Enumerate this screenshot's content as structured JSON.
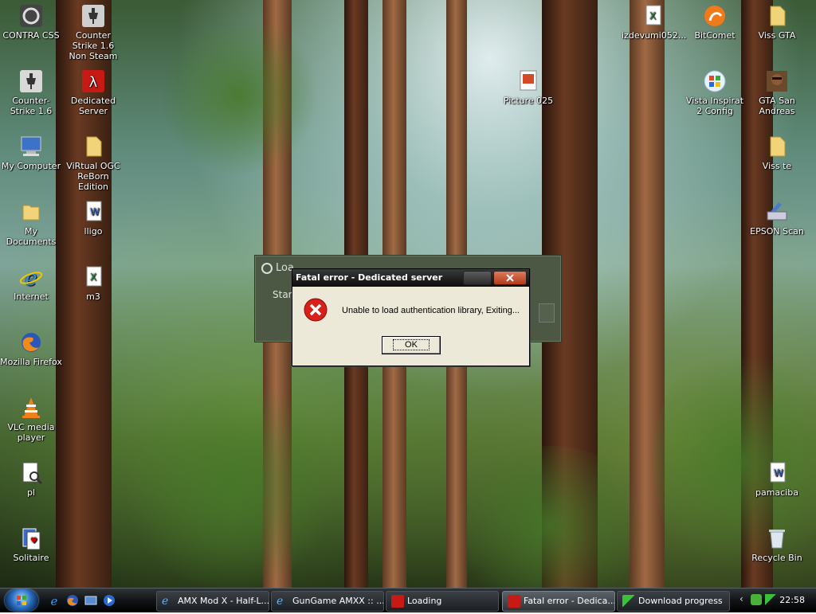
{
  "desktop": {
    "icons": [
      {
        "label": "CONTRA CSS"
      },
      {
        "label": "Counter Strike 1.6 Non Steam"
      },
      {
        "label": "Counter-Strike 1.6"
      },
      {
        "label": "Dedicated Server"
      },
      {
        "label": "My Computer"
      },
      {
        "label": "ViRtual OGC ReBorn Edition"
      },
      {
        "label": "My Documents"
      },
      {
        "label": "lligo"
      },
      {
        "label": "Internet"
      },
      {
        "label": "m3"
      },
      {
        "label": "Mozilla Firefox"
      },
      {
        "label": "VLC media player"
      },
      {
        "label": "pl"
      },
      {
        "label": "Solitaire"
      },
      {
        "label": "izdevumi052..."
      },
      {
        "label": "BitComet"
      },
      {
        "label": "Viss GTA"
      },
      {
        "label": "Picture 025"
      },
      {
        "label": "Vista Inspirat 2 Config"
      },
      {
        "label": "GTA San Andreas"
      },
      {
        "label": "Viss te"
      },
      {
        "label": "EPSON Scan"
      },
      {
        "label": "pamaciba"
      },
      {
        "label": "Recycle Bin"
      }
    ]
  },
  "loading_window": {
    "title": "Loa",
    "body": "Star"
  },
  "dialog": {
    "title": "Fatal error - Dedicated server",
    "message": "Unable to load authentication library, Exiting...",
    "ok_label": "OK"
  },
  "taskbar": {
    "tasks": [
      {
        "label": "AMX Mod X - Half-L..."
      },
      {
        "label": "GunGame AMXX :: ..."
      },
      {
        "label": "Loading"
      },
      {
        "label": "Fatal error - Dedica..."
      },
      {
        "label": "Download progress"
      }
    ],
    "clock": "22:58"
  }
}
